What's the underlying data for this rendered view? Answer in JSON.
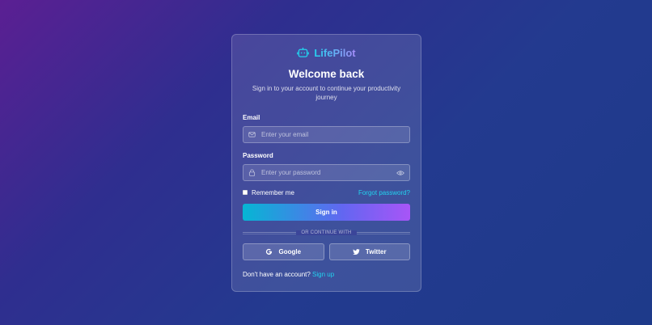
{
  "brand": {
    "name": "LifePilot",
    "icon": "robot-icon"
  },
  "header": {
    "title": "Welcome back",
    "subtitle": "Sign in to your account to continue your productivity journey"
  },
  "email": {
    "label": "Email",
    "placeholder": "Enter your email",
    "icon": "mail-icon"
  },
  "password": {
    "label": "Password",
    "placeholder": "Enter your password",
    "icon": "lock-icon",
    "toggle_icon": "eye-icon"
  },
  "remember": {
    "label": "Remember me",
    "checked": false
  },
  "forgot": {
    "label": "Forgot password?"
  },
  "signin": {
    "label": "Sign in"
  },
  "divider": {
    "label": "OR CONTINUE WITH"
  },
  "social": {
    "google": {
      "label": "Google",
      "icon": "google-icon"
    },
    "twitter": {
      "label": "Twitter",
      "icon": "twitter-icon"
    }
  },
  "footer": {
    "prompt": "Don't have an account?",
    "link": "Sign up"
  },
  "colors": {
    "accent": "#22d3ee",
    "gradient_start": "#06b6d4",
    "gradient_end": "#a855f7"
  }
}
